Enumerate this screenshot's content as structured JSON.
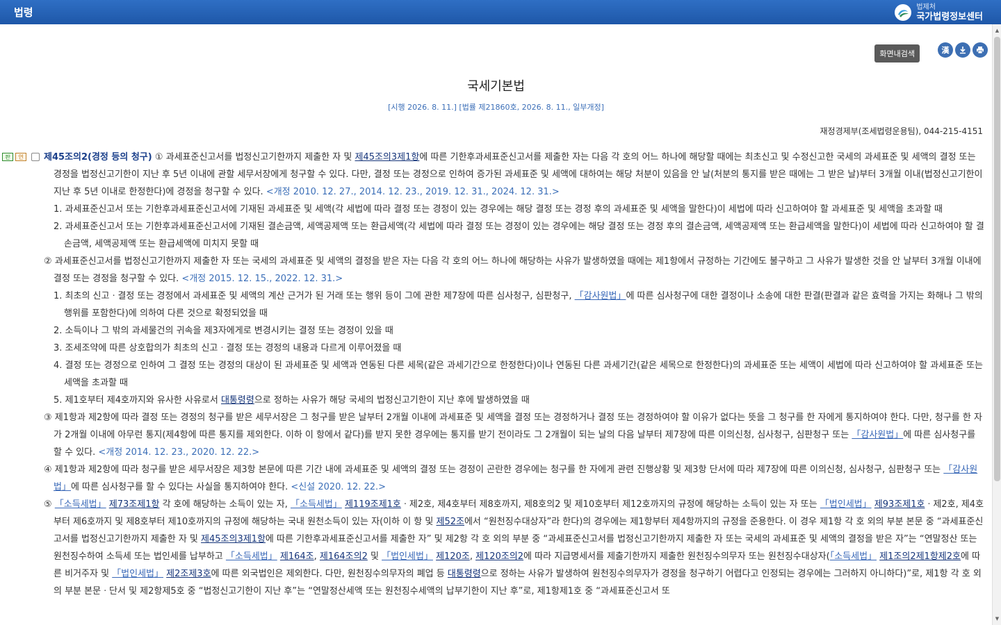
{
  "app": {
    "title": "법령",
    "brand_sub": "법제처",
    "brand_main": "국가법령정보센터"
  },
  "tools": {
    "search_label": "화면내검색",
    "hanja_label": "漢",
    "download_icon": "download-icon",
    "print_icon": "print-icon"
  },
  "law": {
    "title": "국세기본법",
    "subtitle": "[시행 2026. 8. 11.] [법률 제21860호, 2026. 8. 11., 일부개정]",
    "ministry": "재정경제부(조세법령운용팀), 044-215-4151"
  },
  "badges": {
    "pan": "판",
    "yeon": "연"
  },
  "article": {
    "head": "제45조의2(경정 등의 청구)",
    "p1a": " ① 과세표준신고서를 법정신고기한까지 제출한 자 및 ",
    "p1_link": "제45조의3제1항",
    "p1b": "에 따른 기한후과세표준신고서를 제출한 자는 다음 각 호의 어느 하나에 해당할 때에는 최초신고 및 수정신고한 국세의 과세표준 및 세액의 결정 또는 경정을 법정신고기한이 지난 후 5년 이내에 관할 세무서장에게 청구할 수 있다. 다만, 결정 또는 경정으로 인하여 증가된 과세표준 및 세액에 대하여는 해당 처분이 있음을 안 날(처분의 통지를 받은 때에는 그 받은 날)부터 3개월 이내(법정신고기한이 지난 후 5년 이내로 한정한다)에 경정을 청구할 수 있다. ",
    "p1_amend": "<개정 2010. 12. 27., 2014. 12. 23., 2019. 12. 31., 2024. 12. 31.>",
    "p1_i1": "1. 과세표준신고서 또는 기한후과세표준신고서에 기재된 과세표준 및 세액(각 세법에 따라 결정 또는 경정이 있는 경우에는 해당 결정 또는 경정 후의 과세표준 및 세액을 말한다)이 세법에 따라 신고하여야 할 과세표준 및 세액을 초과할 때",
    "p1_i2": "2. 과세표준신고서 또는 기한후과세표준신고서에 기재된 결손금액, 세액공제액 또는 환급세액(각 세법에 따라 결정 또는 경정이 있는 경우에는 해당 결정 또는 경정 후의 결손금액, 세액공제액 또는 환급세액을 말한다)이 세법에 따라 신고하여야 할 결손금액, 세액공제액 또는 환급세액에 미치지 못할 때",
    "p2": "② 과세표준신고서를 법정신고기한까지 제출한 자 또는 국세의 과세표준 및 세액의 결정을 받은 자는 다음 각 호의 어느 하나에 해당하는 사유가 발생하였을 때에는 제1항에서 규정하는 기간에도 불구하고 그 사유가 발생한 것을 안 날부터 3개월 이내에 결정 또는 경정을 청구할 수 있다. ",
    "p2_amend": "<개정 2015. 12. 15., 2022. 12. 31.>",
    "p2_i1a": "1. 최초의 신고ㆍ결정 또는 경정에서 과세표준 및 세액의 계산 근거가 된 거래 또는 행위 등이 그에 관한 제7장에 따른 심사청구, 심판청구, ",
    "p2_i1_link": "「감사원법」",
    "p2_i1b": "에 따른 심사청구에 대한 결정이나 소송에 대한 판결(판결과 같은 효력을 가지는 화해나 그 밖의 행위를 포함한다)에 의하여 다른 것으로 확정되었을 때",
    "p2_i2": "2. 소득이나 그 밖의 과세물건의 귀속을 제3자에게로 변경시키는 결정 또는 경정이 있을 때",
    "p2_i3": "3. 조세조약에 따른 상호합의가 최초의 신고ㆍ결정 또는 경정의 내용과 다르게 이루어졌을 때",
    "p2_i4": "4. 결정 또는 경정으로 인하여 그 결정 또는 경정의 대상이 된 과세표준 및 세액과 연동된 다른 세목(같은 과세기간으로 한정한다)이나 연동된 다른 과세기간(같은 세목으로 한정한다)의 과세표준 또는 세액이 세법에 따라 신고하여야 할 과세표준 또는 세액을 초과할 때",
    "p2_i5a": "5. 제1호부터 제4호까지와 유사한 사유로서 ",
    "p2_i5_link": "대통령령",
    "p2_i5b": "으로 정하는 사유가 해당 국세의 법정신고기한이 지난 후에 발생하였을 때",
    "p3a": "③ 제1항과 제2항에 따라 결정 또는 경정의 청구를 받은 세무서장은 그 청구를 받은 날부터 2개월 이내에 과세표준 및 세액을 결정 또는 경정하거나 결정 또는 경정하여야 할 이유가 없다는 뜻을 그 청구를 한 자에게 통지하여야 한다. 다만, 청구를 한 자가 2개월 이내에 아무런 통지(제4항에 따른 통지를 제외한다. 이하 이 항에서 같다)를 받지 못한 경우에는 통지를 받기 전이라도 그 2개월이 되는 날의 다음 날부터 제7장에 따른 이의신청, 심사청구, 심판청구 또는 ",
    "p3_link": "「감사원법」",
    "p3b": "에 따른 심사청구를 할 수 있다. ",
    "p3_amend": "<개정 2014. 12. 23., 2020. 12. 22.>",
    "p4a": "④ 제1항과 제2항에 따라 청구를 받은 세무서장은 제3항 본문에 따른 기간 내에 과세표준 및 세액의 결정 또는 경정이 곤란한 경우에는 청구를 한 자에게 관련 진행상황 및 제3항 단서에 따라 제7장에 따른 이의신청, 심사청구, 심판청구 또는 ",
    "p4_link": "「감사원법」",
    "p4b": "에 따른 심사청구를 할 수 있다는 사실을 통지하여야 한다. ",
    "p4_amend": "<신설 2020. 12. 22.>",
    "p5_0": "⑤ ",
    "p5_l1": "「소득세법」",
    "p5_l2": "제73조제1항",
    "p5_1": " 각 호에 해당하는 소득이 있는 자, ",
    "p5_l3": "「소득세법」",
    "p5_l4": "제119조제1호",
    "p5_2": "ㆍ제2호, 제4호부터 제8호까지, 제8호의2 및 제10호부터 제12호까지의 규정에 해당하는 소득이 있는 자 또는 ",
    "p5_l5": "「법인세법」",
    "p5_l6": "제93조제1호",
    "p5_3": "ㆍ제2호, 제4호부터 제6호까지 및 제8호부터 제10호까지의 규정에 해당하는 국내 원천소득이 있는 자(이하 이 항 및 ",
    "p5_l7": "제52조",
    "p5_4": "에서 “원천징수대상자”라 한다)의 경우에는 제1항부터 제4항까지의 규정을 준용한다. 이 경우 제1항 각 호 외의 부분 본문 중 “과세표준신고서를 법정신고기한까지 제출한 자 및 ",
    "p5_l8": "제45조의3제1항",
    "p5_5": "에 따른 기한후과세표준신고서를 제출한 자” 및 제2항 각 호 외의 부분 중 “과세표준신고서를 법정신고기한까지 제출한 자 또는 국세의 과세표준 및 세액의 결정을 받은 자”는 “연말정산 또는 원천징수하여 소득세 또는 법인세를 납부하고 ",
    "p5_l9": "「소득세법」",
    "p5_l10": "제164조",
    "p5_6": ", ",
    "p5_l11": "제164조의2",
    "p5_7": " 및 ",
    "p5_l12": "「법인세법」",
    "p5_l13": "제120조",
    "p5_8": ", ",
    "p5_l14": "제120조의2",
    "p5_9": "에 따라 지급명세서를 제출기한까지 제출한 원천징수의무자 또는 원천징수대상자(",
    "p5_l15": "「소득세법」",
    "p5_l16": "제1조의2제1항제2호",
    "p5_10": "에 따른 비거주자 및 ",
    "p5_l17": "「법인세법」",
    "p5_l18": "제2조제3호",
    "p5_11": "에 따른 외국법인은 제외한다. 다만, 원천징수의무자의 폐업 등 ",
    "p5_l19": "대통령령",
    "p5_12": "으로 정하는 사유가 발생하여 원천징수의무자가 경정을 청구하기 어렵다고 인정되는 경우에는 그러하지 아니하다)”로, 제1항 각 호 외의 부분 본문ㆍ단서 및 제2항제5호 중 “법정신고기한이 지난 후”는 “연말정산세액 또는 원천징수세액의 납부기한이 지난 후”로, 제1항제1호 중 “과세표준신고서 또"
  }
}
